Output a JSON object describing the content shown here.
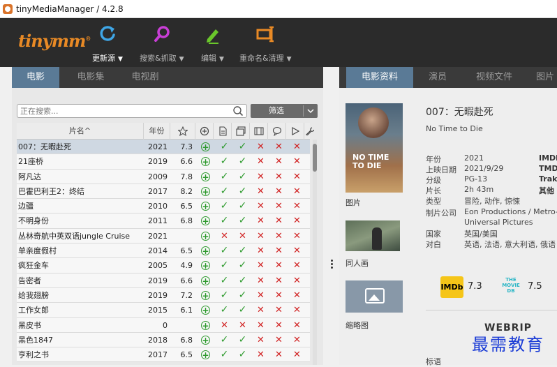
{
  "window": {
    "title": "tinyMediaManager / 4.2.8"
  },
  "logo": "tinymm",
  "toolbar": [
    {
      "label": "更新源",
      "icon": "refresh-icon",
      "color": "#3fa6e6"
    },
    {
      "label": "搜索&抓取",
      "icon": "search-icon",
      "color": "#c93ed6"
    },
    {
      "label": "编辑",
      "icon": "edit-icon",
      "color": "#6ac72b"
    },
    {
      "label": "重命名&清理",
      "icon": "rename-icon",
      "color": "#e98a25"
    }
  ],
  "left_tabs": [
    "电影",
    "电影集",
    "电视剧"
  ],
  "right_tabs": [
    "电影资料",
    "演员",
    "视频文件",
    "图片"
  ],
  "search": {
    "placeholder": "正在搜索..."
  },
  "filter": {
    "label": "筛选"
  },
  "table": {
    "columns": {
      "title": "片名^",
      "year": "年份"
    },
    "rows": [
      {
        "title": "007：无暇赴死",
        "year": "2021",
        "rating": "7.3",
        "flags": [
          "plus",
          "ok",
          "ok",
          "no",
          "no",
          "no"
        ]
      },
      {
        "title": "21座桥",
        "year": "2019",
        "rating": "6.6",
        "flags": [
          "plus",
          "ok",
          "ok",
          "no",
          "no",
          "no"
        ]
      },
      {
        "title": "阿凡达",
        "year": "2009",
        "rating": "7.8",
        "flags": [
          "plus",
          "ok",
          "ok",
          "no",
          "no",
          "no"
        ]
      },
      {
        "title": "巴霍巴利王2：终结",
        "year": "2017",
        "rating": "8.2",
        "flags": [
          "plus",
          "ok",
          "ok",
          "no",
          "no",
          "no"
        ]
      },
      {
        "title": "边疆",
        "year": "2010",
        "rating": "6.5",
        "flags": [
          "plus",
          "ok",
          "ok",
          "no",
          "no",
          "no"
        ]
      },
      {
        "title": "不明身份",
        "year": "2011",
        "rating": "6.8",
        "flags": [
          "plus",
          "ok",
          "ok",
          "no",
          "no",
          "no"
        ]
      },
      {
        "title": "丛林奇航中英双语jungle Cruise",
        "year": "2021",
        "rating": "",
        "flags": [
          "plus",
          "no",
          "no",
          "no",
          "no",
          "no"
        ]
      },
      {
        "title": "单亲度假村",
        "year": "2014",
        "rating": "6.5",
        "flags": [
          "plus",
          "ok",
          "ok",
          "no",
          "no",
          "no"
        ]
      },
      {
        "title": "疯狂金车",
        "year": "2005",
        "rating": "4.9",
        "flags": [
          "plus",
          "ok",
          "ok",
          "no",
          "no",
          "no"
        ]
      },
      {
        "title": "告密者",
        "year": "2019",
        "rating": "6.6",
        "flags": [
          "plus",
          "ok",
          "ok",
          "no",
          "no",
          "no"
        ]
      },
      {
        "title": "给我翅膀",
        "year": "2019",
        "rating": "7.2",
        "flags": [
          "plus",
          "ok",
          "ok",
          "no",
          "no",
          "no"
        ]
      },
      {
        "title": "工作女郎",
        "year": "2015",
        "rating": "6.1",
        "flags": [
          "plus",
          "ok",
          "ok",
          "no",
          "no",
          "no"
        ]
      },
      {
        "title": "黑皮书",
        "year": "0",
        "rating": "",
        "flags": [
          "plus",
          "no",
          "no",
          "no",
          "no",
          "no"
        ]
      },
      {
        "title": "黑色1847",
        "year": "2018",
        "rating": "6.8",
        "flags": [
          "plus",
          "ok",
          "ok",
          "no",
          "no",
          "no"
        ]
      },
      {
        "title": "亨利之书",
        "year": "2017",
        "rating": "6.5",
        "flags": [
          "plus",
          "ok",
          "ok",
          "no",
          "no",
          "no"
        ]
      }
    ]
  },
  "detail": {
    "title": "007：无暇赴死",
    "original_title": "No Time to Die",
    "poster_text": "NO TIME TO DIE",
    "poster_caption": "图片",
    "fanart_caption": "同人画",
    "thumb_caption": "缩略图",
    "info": [
      {
        "key": "年份",
        "value": "2021",
        "extra": "IMDb"
      },
      {
        "key": "上映日期",
        "value": "2021/9/29",
        "extra": "TMDb"
      },
      {
        "key": "分级",
        "value": "PG-13",
        "extra": "Trakt"
      },
      {
        "key": "片长",
        "value": "2h 43m",
        "extra": "其他"
      },
      {
        "key": "类型",
        "value": "冒险, 动作, 惊悚",
        "extra": ""
      },
      {
        "key": "制片公司",
        "value": "Eon Productions / Metro-G",
        "extra": ""
      },
      {
        "key": "",
        "value": "Universal Pictures",
        "extra": ""
      },
      {
        "key": "国家",
        "value": "英国/美国",
        "extra": ""
      },
      {
        "key": "对白",
        "value": "英语, 法语, 意大利语, 俄语",
        "extra": ""
      }
    ],
    "imdb_label": "IMDb",
    "imdb_rating": "7.3",
    "tmdb_label": "THE MOVIE DB",
    "tmdb_rating": "7.5",
    "source": "WEBRIP",
    "tags_label": "标语"
  },
  "watermark": "最需教育"
}
